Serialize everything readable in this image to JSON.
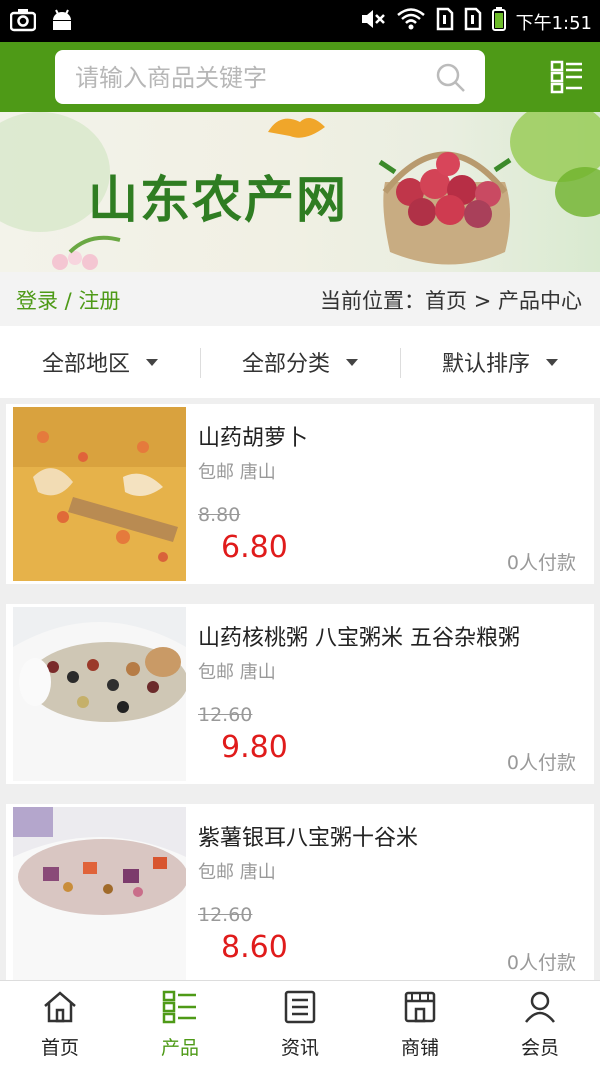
{
  "status_bar": {
    "time": "下午1:51",
    "icons": [
      "screenshot-icon",
      "android-icon",
      "mute-icon",
      "wifi-icon",
      "sim1-icon",
      "sim2-icon",
      "battery-icon"
    ]
  },
  "header": {
    "search_placeholder": "请输入商品关键字",
    "icons": [
      "search-icon",
      "category-menu-icon"
    ],
    "brand_color": "#4e9a17"
  },
  "banner": {
    "title": "山东农产网"
  },
  "breadcrumb": {
    "login": "登录 / 注册",
    "location": "当前位置：首页 > 产品中心"
  },
  "filters": [
    {
      "label": "全部地区"
    },
    {
      "label": "全部分类"
    },
    {
      "label": "默认排序"
    }
  ],
  "products": [
    {
      "name": "山药胡萝卜",
      "meta": "包邮 唐山",
      "old_price": "8.80",
      "price": "6.80",
      "paid": "0人付款"
    },
    {
      "name": "山药核桃粥 八宝粥米 五谷杂粮粥",
      "meta": "包邮 唐山",
      "old_price": "12.60",
      "price": "9.80",
      "paid": "0人付款"
    },
    {
      "name": "紫薯银耳八宝粥十谷米",
      "meta": "包邮 唐山",
      "old_price": "12.60",
      "price": "8.60",
      "paid": "0人付款"
    }
  ],
  "tabbar": {
    "items": [
      {
        "label": "首页",
        "icon": "home-icon"
      },
      {
        "label": "产品",
        "icon": "products-icon",
        "active": true
      },
      {
        "label": "资讯",
        "icon": "news-icon"
      },
      {
        "label": "商铺",
        "icon": "shop-icon"
      },
      {
        "label": "会员",
        "icon": "member-icon"
      }
    ]
  },
  "colors": {
    "price": "#e01b1b",
    "accent": "#4e9a17"
  }
}
